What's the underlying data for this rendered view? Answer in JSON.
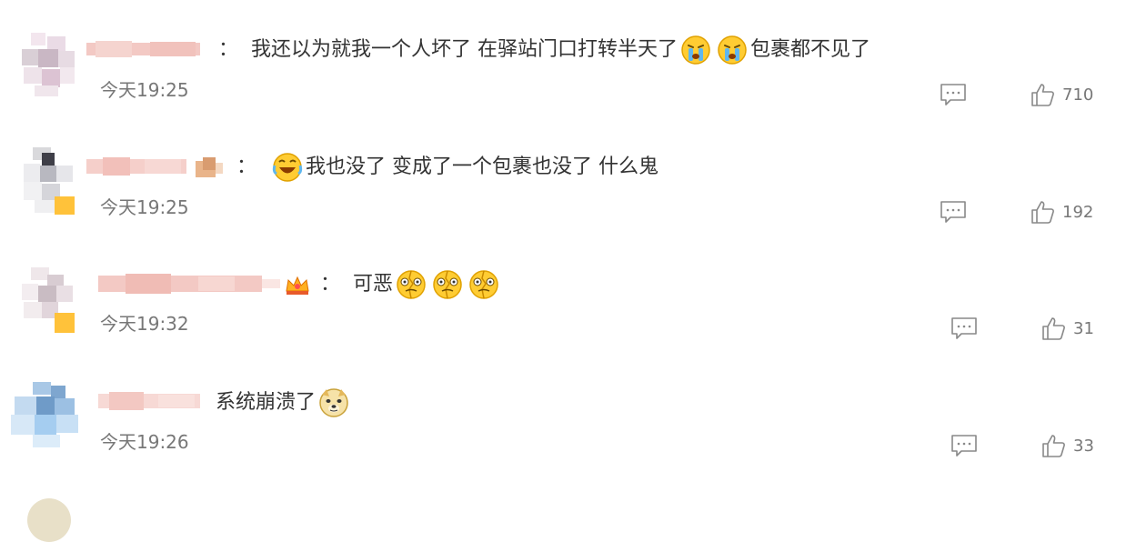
{
  "comments": [
    {
      "time": "今天19:25",
      "colon": "：",
      "text_before": "我还以为就我一个人坏了 在驿站门口打转半天了",
      "emojis_mid": [
        "crying-face",
        "crying-face"
      ],
      "text_after": "包裹都不见了",
      "likes": "710",
      "reply_icon": "comment-icon",
      "like_icon": "thumbs-up-icon"
    },
    {
      "time": "今天19:25",
      "colon": "：",
      "emoji_lead": "laughing-tears-face",
      "text_after": "我也没了 变成了一个包裹也没了 什么鬼",
      "likes": "192"
    },
    {
      "time": "今天19:32",
      "colon": "：",
      "text_before": "可恶",
      "emojis_mid": [
        "cracked-face",
        "cracked-face",
        "cracked-face"
      ],
      "likes": "31"
    },
    {
      "time": "今天19:26",
      "text_before": "系统崩溃了",
      "emojis_mid": [
        "doge-face"
      ],
      "likes": "33"
    }
  ],
  "colors": {
    "text": "#333333",
    "meta": "#777777",
    "icon": "#888888"
  }
}
